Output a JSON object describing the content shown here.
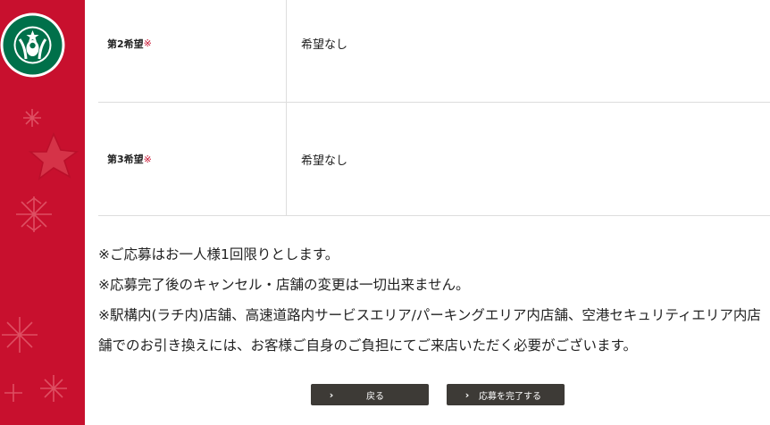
{
  "brand": {
    "accent_color": "#c8102e",
    "button_color": "#3d3a36"
  },
  "form": {
    "rows": [
      {
        "label": "第2希望",
        "required_mark": "※",
        "value": "希望なし"
      },
      {
        "label": "第3希望",
        "required_mark": "※",
        "value": "希望なし"
      }
    ]
  },
  "notes": [
    "※ご応募はお一人様1回限りとします。",
    "※応募完了後のキャンセル・店舗の変更は一切出来ません。",
    "※駅構内(ラチ内)店舗、高速道路内サービスエリア/パーキングエリア内店舗、空港セキュリティエリア内店舗でのお引き換えには、お客様ご自身のご負担にてご来店いただく必要がございます。"
  ],
  "buttons": {
    "back_label": "戻る",
    "submit_label": "応募を完了する",
    "chevron_icon": "chevron-right-icon"
  }
}
